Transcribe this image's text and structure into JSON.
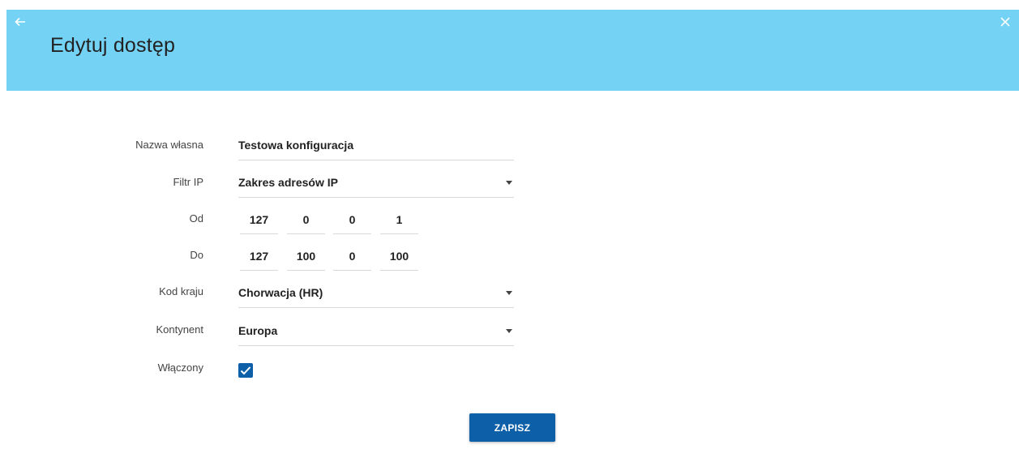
{
  "header": {
    "title": "Edytuj dostęp",
    "background": "#74d2f4",
    "back_icon": "arrow-left-icon",
    "close_icon": "close-icon"
  },
  "form": {
    "name": {
      "label": "Nazwa własna",
      "value": "Testowa konfiguracja"
    },
    "ip_filter": {
      "label": "Filtr IP",
      "value": "Zakres adresów IP"
    },
    "ip_from": {
      "label": "Od",
      "octets": [
        "127",
        "0",
        "0",
        "1"
      ]
    },
    "ip_to": {
      "label": "Do",
      "octets": [
        "127",
        "100",
        "0",
        "100"
      ]
    },
    "country_code": {
      "label": "Kod kraju",
      "value": "Chorwacja (HR)"
    },
    "continent": {
      "label": "Kontynent",
      "value": "Europa"
    },
    "enabled": {
      "label": "Włączony",
      "checked": true
    }
  },
  "actions": {
    "save_label": "ZAPISZ",
    "accent": "#0d5fa8"
  }
}
